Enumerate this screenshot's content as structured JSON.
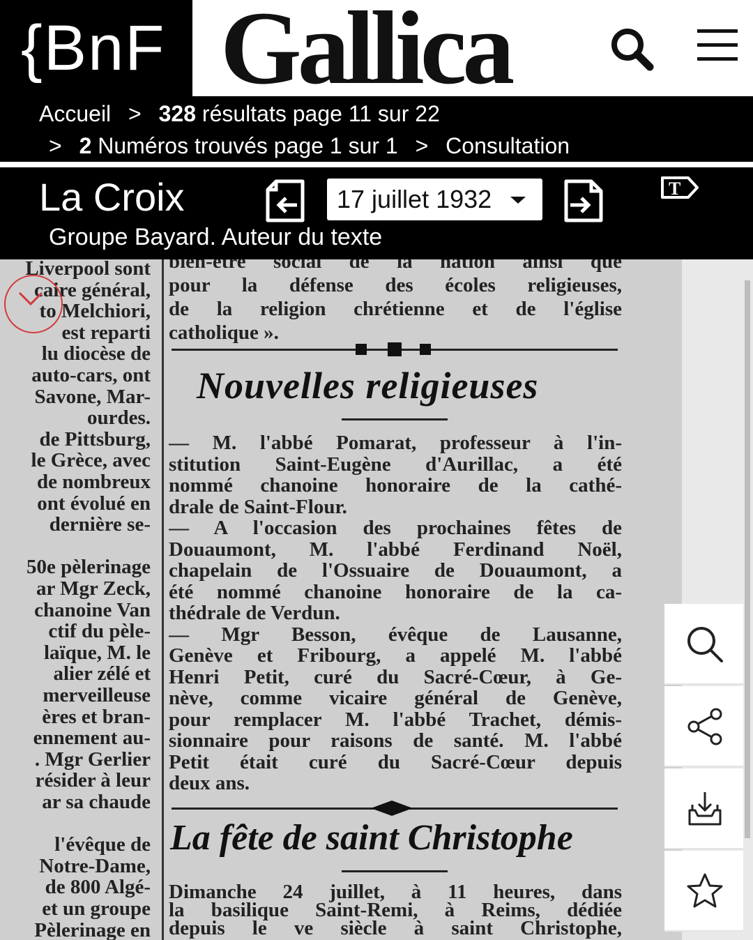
{
  "header": {
    "bnf_logo": "{BnF",
    "gallica_logo": "Gallica"
  },
  "breadcrumb": {
    "home": "Accueil",
    "sep": ">",
    "results_count": "328",
    "results_text": " résultats page 11 sur 22",
    "issues_count": "2",
    "issues_text": " Numéros trouvés page 1 sur 1",
    "current": "Consultation"
  },
  "document": {
    "title": "La Croix",
    "author": "Groupe Bayard. Auteur du texte",
    "date": "17 juillet 1932",
    "text_mode_label": "T"
  },
  "scan": {
    "left_column": [
      "Liverpool sont",
      "caire général,",
      "to Melchiori,",
      "est reparti",
      "lu diocèse de",
      "auto-cars, ont",
      "Savone, Mar-",
      "ourdes.",
      "de Pittsburg,",
      "le Grèce, avec",
      "de nombreux",
      "ont évolué en",
      "dernière se-",
      "",
      "50e pèlerinage",
      "ar Mgr Zeck,",
      "chanoine Van",
      "ctif du pèle-",
      "laïque, M. le",
      "alier zélé et",
      "merveilleuse",
      "ères et bran-",
      "ennement au-",
      ". Mgr Gerlier",
      "résider à leur",
      "ar sa chaude",
      "",
      "l'évêque de",
      "Notre-Dame,",
      "de 800 Algé-",
      "et un groupe",
      "Pèlerinage en"
    ],
    "right_top": [
      "bien-être social de la nation ainsi que",
      "pour la défense des écoles religieuses,",
      "de la religion chrétienne et de l'église",
      "catholique »."
    ],
    "headline1": "Nouvelles religieuses",
    "right_mid": [
      "— M. l'abbé Pomarat, professeur à l'in-",
      "stitution Saint-Eugène d'Aurillac, a été",
      "nommé chanoine honoraire de la cathé-",
      "drale de Saint-Flour.",
      "— A l'occasion des prochaines fêtes de",
      "Douaumont, M. l'abbé Ferdinand Noël,",
      "chapelain de l'Ossuaire de Douaumont, a",
      "été nommé chanoine honoraire de la ca-",
      "thédrale de Verdun.",
      "— Mgr Besson, évêque de Lausanne,",
      "Genève et Fribourg, a appelé M. l'abbé",
      "Henri Petit, curé du Sacré-Cœur, à Ge-",
      "nève, comme vicaire général de Genève,",
      "pour remplacer M. l'abbé Trachet, démis-",
      "sionnaire pour raisons de santé. M. l'abbé",
      "Petit était curé du Sacré-Cœur depuis",
      "deux ans."
    ],
    "headline2": "La fête de saint Christophe",
    "right_bottom": [
      "Dimanche 24 juillet, à 11 heures, dans",
      "la basilique Saint-Remi, à Reims, dédiée",
      "depuis le ve siècle à saint Christophe,"
    ]
  },
  "tools": [
    "search-icon",
    "share-icon",
    "download-icon",
    "star-icon"
  ]
}
